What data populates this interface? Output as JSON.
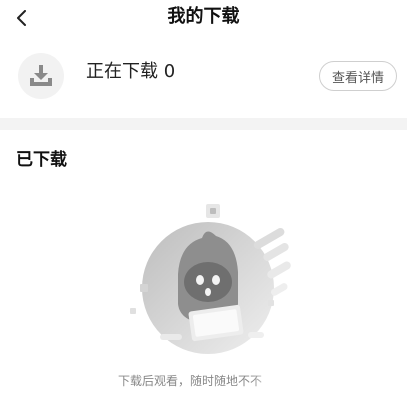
{
  "header": {
    "back_icon": "chevron-left-icon",
    "title": "我的下载"
  },
  "downloading": {
    "icon": "download-tray-icon",
    "label": "正在下载 0",
    "detail_button": "查看详情"
  },
  "downloaded": {
    "section_title": "已下载",
    "empty_illustration": "mascot-empty-illustration",
    "empty_message": "下载后观看，随时随地不不"
  },
  "colors": {
    "background": "#ffffff",
    "separator": "#f3f3f3",
    "icon_gray": "#8a8a8a"
  }
}
